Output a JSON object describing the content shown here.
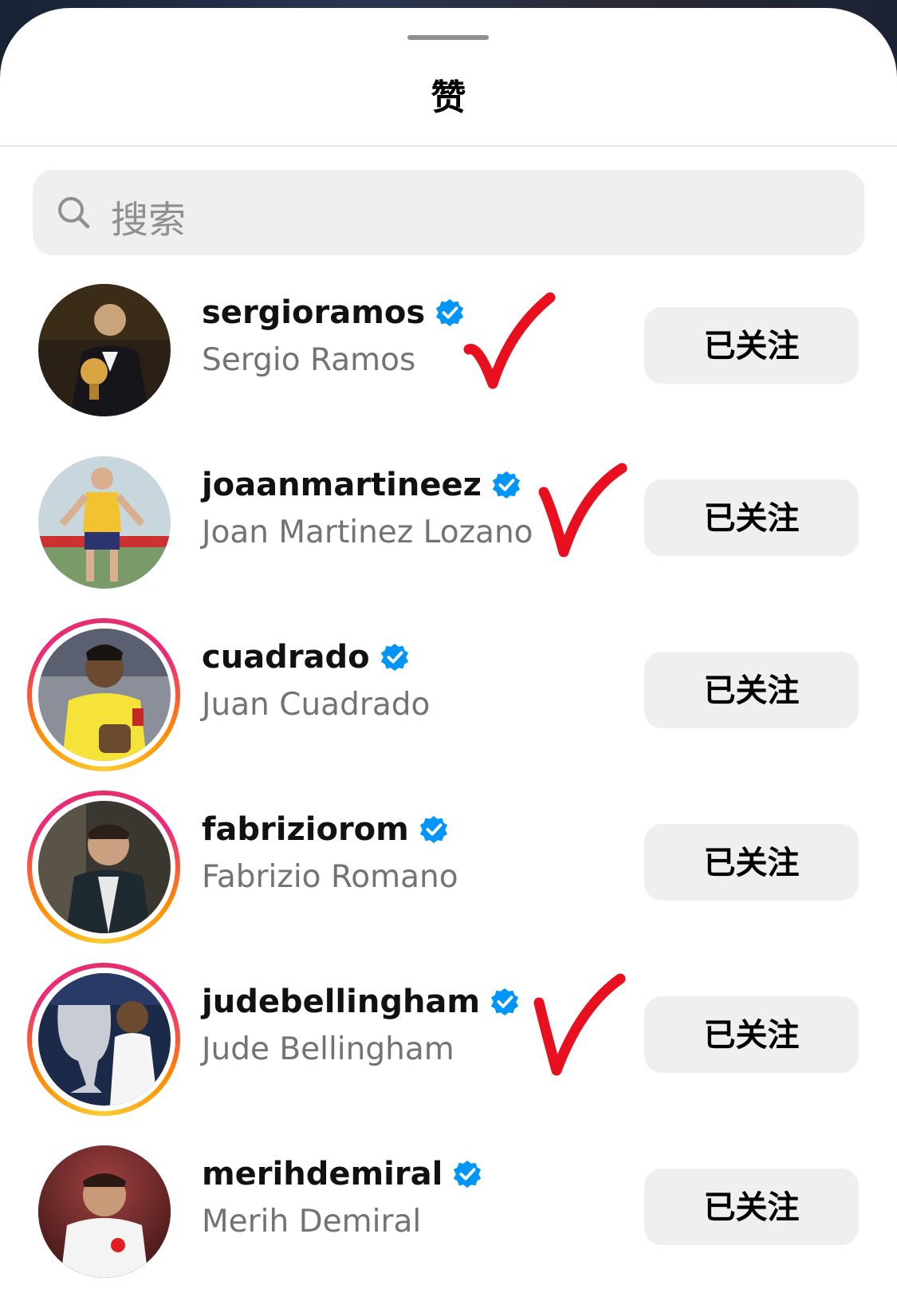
{
  "sheet": {
    "title": "赞",
    "search": {
      "placeholder": "搜索"
    }
  },
  "users": [
    {
      "username": "sergioramos",
      "full_name": "Sergio Ramos",
      "verified": true,
      "story_ring": false,
      "button_label": "已关注",
      "checked": true
    },
    {
      "username": "joaanmartineez",
      "full_name": "Joan Martinez Lozano",
      "verified": true,
      "story_ring": false,
      "button_label": "已关注",
      "checked": true
    },
    {
      "username": "cuadrado",
      "full_name": "Juan Cuadrado",
      "verified": true,
      "story_ring": true,
      "button_label": "已关注",
      "checked": false
    },
    {
      "username": "fabriziorom",
      "full_name": "Fabrizio Romano",
      "verified": true,
      "story_ring": true,
      "button_label": "已关注",
      "checked": false
    },
    {
      "username": "judebellingham",
      "full_name": "Jude Bellingham",
      "verified": true,
      "story_ring": true,
      "button_label": "已关注",
      "checked": true
    },
    {
      "username": "merihdemiral",
      "full_name": "Merih Demiral",
      "verified": true,
      "story_ring": false,
      "button_label": "已关注",
      "checked": false
    }
  ],
  "colors": {
    "verified_badge": "#0095f6",
    "annotation_check": "#e8101f",
    "button_bg": "#efeff0",
    "secondary_text": "#737373"
  }
}
